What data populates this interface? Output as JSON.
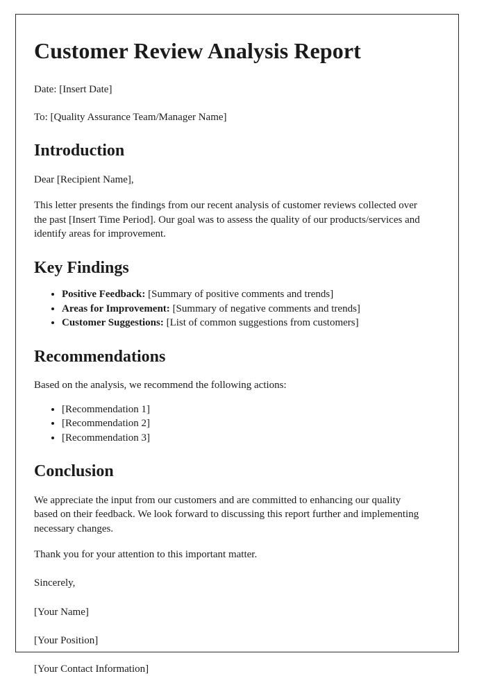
{
  "document": {
    "title": "Customer Review Analysis Report",
    "meta": [
      {
        "label": "Date:",
        "value": "[Insert Date]",
        "full": "Date: [Insert Date]"
      },
      {
        "label": "To:",
        "value": "[Quality Assurance Team/Manager Name]",
        "full": "To: [Quality Assurance Team/Manager Name]"
      }
    ],
    "sections": [
      {
        "heading": "Introduction",
        "salutation": "Dear [Recipient Name],",
        "paragraph": "This letter presents the findings from our recent analysis of customer reviews collected over the past [Insert Time Period]. Our goal was to assess the quality of our products/services and identify areas for improvement."
      },
      {
        "heading": "Key Findings",
        "bullets": [
          {
            "lead": "Positive Feedback:",
            "rest": " [Summary of positive comments and trends]"
          },
          {
            "lead": "Areas for Improvement:",
            "rest": " [Summary of negative comments and trends]"
          },
          {
            "lead": "Customer Suggestions:",
            "rest": " [List of common suggestions from customers]"
          }
        ]
      },
      {
        "heading": "Recommendations",
        "paragraph": "Based on the analysis, we recommend the following actions:",
        "bullets": [
          {
            "lead": "",
            "rest": "[Recommendation 1]"
          },
          {
            "lead": "",
            "rest": "[Recommendation 2]"
          },
          {
            "lead": "",
            "rest": "[Recommendation 3]"
          }
        ]
      },
      {
        "heading": "Conclusion",
        "paragraph": "We appreciate the input from our customers and are committed to enhancing our quality based on their feedback. We look forward to discussing this report further and implementing necessary changes.",
        "paragraph2": "Thank you for your attention to this important matter."
      }
    ],
    "signature": [
      "Sincerely,",
      "[Your Name]",
      "[Your Position]",
      "[Your Contact Information]"
    ]
  },
  "colors": {
    "page_background": "#ffffff",
    "text": "#1b1b1b",
    "page_border": "#2b2b2b"
  }
}
